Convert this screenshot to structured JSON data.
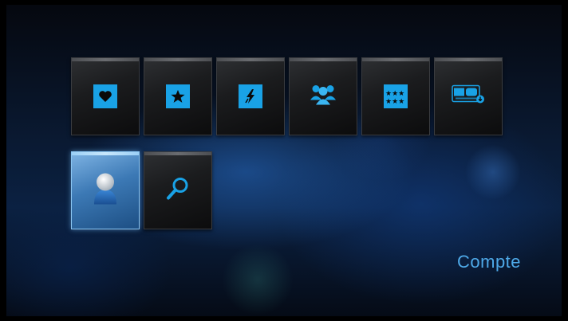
{
  "menu": {
    "row1": [
      {
        "id": "favorites",
        "icon": "heart-icon"
      },
      {
        "id": "featured",
        "icon": "star-icon"
      },
      {
        "id": "popular",
        "icon": "lightning-icon"
      },
      {
        "id": "community",
        "icon": "people-icon"
      },
      {
        "id": "top-rated",
        "icon": "stars-rating-icon"
      },
      {
        "id": "youtube-video",
        "icon": "youtube-video-icon"
      }
    ],
    "row2": [
      {
        "id": "account",
        "icon": "user-icon",
        "selected": true
      },
      {
        "id": "search",
        "icon": "magnifier-icon"
      }
    ]
  },
  "selected_label": "Compte",
  "colors": {
    "accent": "#19a2e6",
    "label": "#4ea9e8",
    "selected_tile": "#3c79b5"
  }
}
